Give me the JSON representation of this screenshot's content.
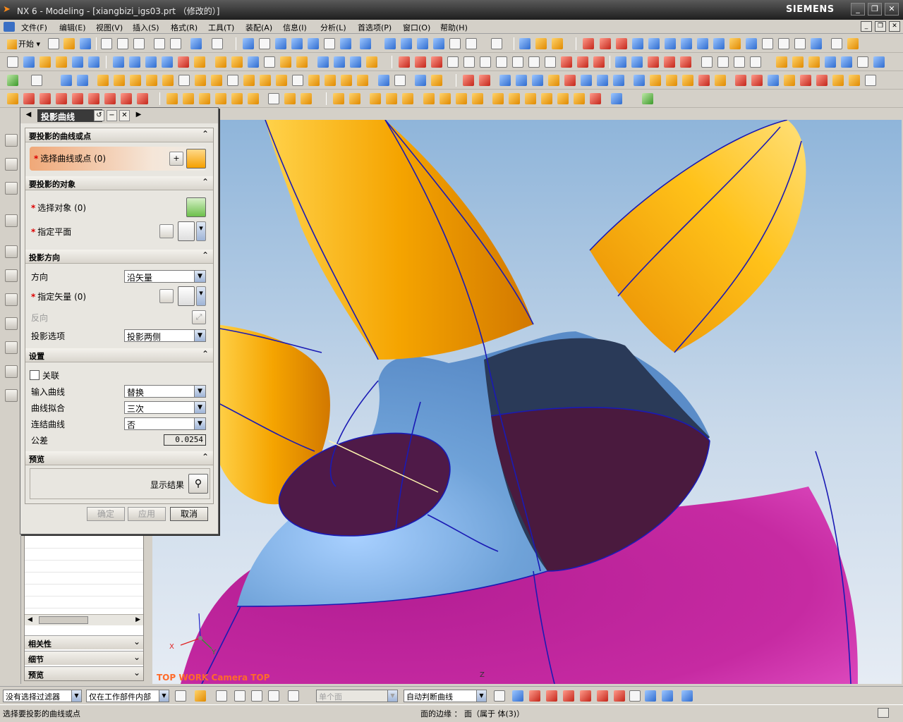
{
  "window": {
    "title": "NX 6 - Modeling - [xiangbizi_igs03.prt （修改的）]",
    "brand": "SIEMENS",
    "buttons": [
      "minimize",
      "restore",
      "close"
    ]
  },
  "menu": {
    "items": [
      "文件(F)",
      "编辑(E)",
      "视图(V)",
      "插入(S)",
      "格式(R)",
      "工具(T)",
      "装配(A)",
      "信息(I)",
      "分析(L)",
      "首选项(P)",
      "窗口(O)",
      "帮助(H)"
    ]
  },
  "toolbar": {
    "start_label": "开始"
  },
  "dialog": {
    "title": "投影曲线",
    "sections": {
      "curves": {
        "title": "要投影的曲线或点",
        "select_label": "选择曲线或点 (0)"
      },
      "target": {
        "title": "要投影的对象",
        "select_object": "选择对象 (0)",
        "specify_plane": "指定平面"
      },
      "direction": {
        "title": "投影方向",
        "direction_label": "方向",
        "direction_value": "沿矢量",
        "vector_label": "指定矢量 (0)",
        "reverse_label": "反向",
        "option_label": "投影选项",
        "option_value": "投影两侧"
      },
      "settings": {
        "title": "设置",
        "associative_label": "关联",
        "input_curves_label": "输入曲线",
        "input_curves_value": "替换",
        "curve_fit_label": "曲线拟合",
        "curve_fit_value": "三次",
        "join_curves_label": "连结曲线",
        "join_curves_value": "否",
        "tolerance_label": "公差",
        "tolerance_value": "0.0254"
      },
      "preview": {
        "title": "预览",
        "show_result_label": "显示结果"
      }
    },
    "buttons": {
      "ok": "确定",
      "apply": "应用",
      "cancel": "取消"
    }
  },
  "nav_panel": {
    "sections": [
      "相关性",
      "细节",
      "预览"
    ]
  },
  "viewport": {
    "camera_label": "TOP WORK Camera TOP",
    "axis_x": "X",
    "axis_y": "Y",
    "axis_z": "Z"
  },
  "selection_bar": {
    "filter": "没有选择过滤器",
    "scope": "仅在工作部件内部",
    "disabled_field": "单个面",
    "curve_rule": "自动判断曲线"
  },
  "status": {
    "prompt": "选择要投影的曲线或点",
    "info": "面的边缘 ： 面（属于 体(3)）"
  },
  "colors": {
    "accent_orange": "#f5a000",
    "body_magenta": "#c8209c",
    "surface_blue": "#6fa2d8",
    "edge_blue": "#1a1ab4",
    "camera_text": "#ff6a2a"
  }
}
